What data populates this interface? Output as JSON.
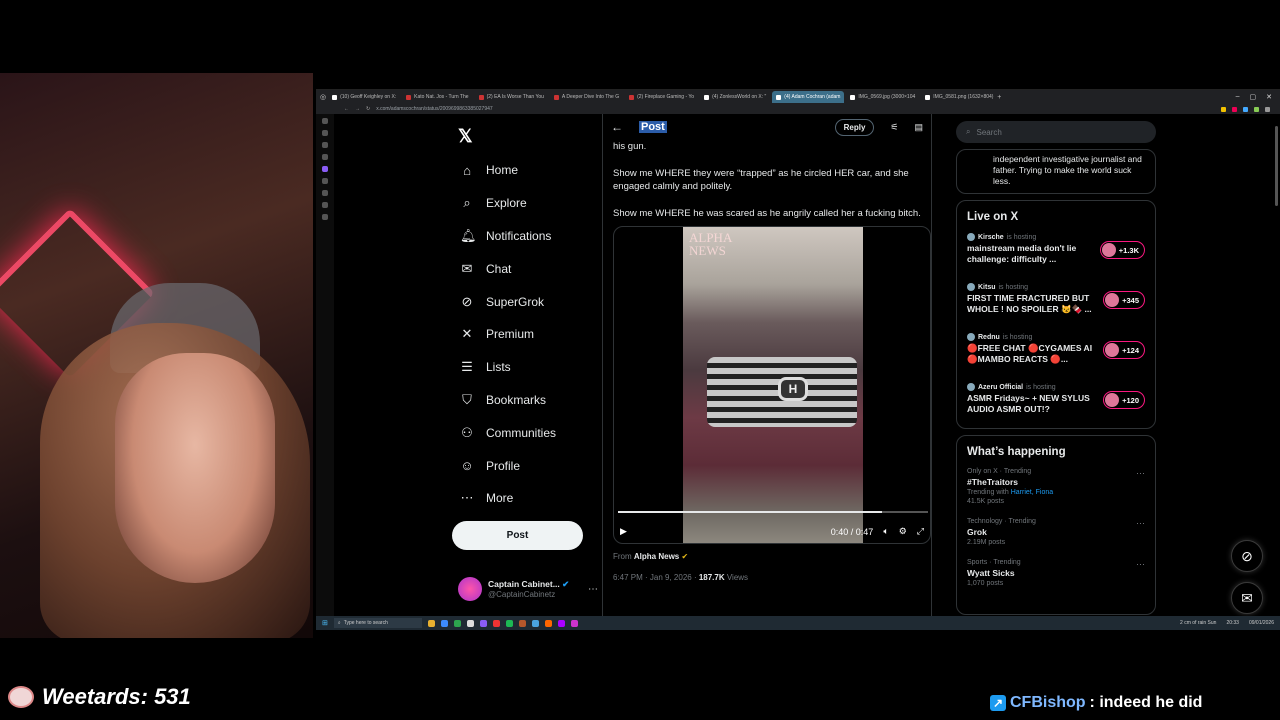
{
  "overlay": {
    "counter_text": "Weetards: 531",
    "chat_user": "CFBishop",
    "chat_message": ": indeed he did"
  },
  "browser": {
    "tabs": [
      {
        "label": "(10) Geoff Keighley on X:"
      },
      {
        "label": "Kato Nat. Jos - Turn The"
      },
      {
        "label": "(2) EA Is Worse Than You"
      },
      {
        "label": "A Deeper Dive Into The G"
      },
      {
        "label": "(2) Fireplace Gaming - Yo"
      },
      {
        "label": "(4) ZonlessWorld on X: \""
      },
      {
        "label": "(4) Adam Cochran (adam"
      },
      {
        "label": "IMG_0569.jpg (3000×104"
      },
      {
        "label": "IMG_0581.png (1632×804)"
      }
    ],
    "url": "x.com/adamscochran/status/2009699863385027947"
  },
  "nav": {
    "items": [
      {
        "label": "Home",
        "icon": "home-icon",
        "glyph": "⌂"
      },
      {
        "label": "Explore",
        "icon": "search-icon",
        "glyph": "⌕"
      },
      {
        "label": "Notifications",
        "icon": "bell-icon",
        "glyph": "♫"
      },
      {
        "label": "Chat",
        "icon": "mail-icon",
        "glyph": "✉"
      },
      {
        "label": "SuperGrok",
        "icon": "grok-icon",
        "glyph": "⊘"
      },
      {
        "label": "Premium",
        "icon": "x-logo-icon",
        "glyph": "✕"
      },
      {
        "label": "Lists",
        "icon": "list-icon",
        "glyph": "☰"
      },
      {
        "label": "Bookmarks",
        "icon": "bookmark-icon",
        "glyph": "⛉"
      },
      {
        "label": "Communities",
        "icon": "people-icon",
        "glyph": "⚇"
      },
      {
        "label": "Profile",
        "icon": "person-icon",
        "glyph": "☺"
      },
      {
        "label": "More",
        "icon": "more-circle-icon",
        "glyph": "⋯"
      }
    ],
    "post_button": "Post",
    "account": {
      "name": "Captain Cabinet...",
      "handle": "@CaptainCabinetz"
    }
  },
  "post": {
    "header_title": "Post",
    "reply_button": "Reply",
    "paragraphs": [
      "his gun.",
      "Show me WHERE they were “trapped” as he circled HER car, and she engaged calmly and politely.",
      "Show me WHERE he was scared as he angrily called her a fucking bitch."
    ],
    "video": {
      "watermark_line1": "ALPHA",
      "watermark_line2": "NEWS",
      "time": "0:40 / 0:47",
      "progress": 0.85
    },
    "from_label": "From ",
    "from_source": "Alpha News",
    "timestamp": "6:47 PM · Jan 9, 2026 · ",
    "views": "187.7K",
    "views_label": " Views"
  },
  "sidebar": {
    "search_placeholder": "Search",
    "bio": "independent investigative journalist and father. Trying to make the world suck less.",
    "live_title": "Live on X",
    "live": [
      {
        "host": "Kirsche",
        "status": "is hosting",
        "title": "mainstream media don't lie challenge: difficulty ...",
        "count": "+1.3K"
      },
      {
        "host": "Kitsu",
        "status": "is hosting",
        "title": "FIRST TIME FRACTURED BUT WHOLE ! NO SPOILER 😼🍫 ...",
        "count": "+345"
      },
      {
        "host": "Rednu",
        "status": "is hosting",
        "title": "🔴FREE CHAT 🔴CYGAMES AI 🔴MAMBO REACTS 🔴...",
        "count": "+124"
      },
      {
        "host": "Azeru Official",
        "status": "is hosting",
        "title": "ASMR Fridays~ + NEW SYLUS AUDIO ASMR OUT!?",
        "count": "+120"
      }
    ],
    "happening_title": "What’s happening",
    "trends": [
      {
        "context": "Only on X · Trending",
        "name": "#TheTraitors",
        "sub_prefix": "Trending with ",
        "sub_links": "Harriet, Fiona",
        "posts": "41.5K posts"
      },
      {
        "context": "Technology · Trending",
        "name": "Grok",
        "sub_prefix": "",
        "sub_links": "",
        "posts": "2.19M posts"
      },
      {
        "context": "Sports · Trending",
        "name": "Wyatt Sicks",
        "sub_prefix": "",
        "sub_links": "",
        "posts": "1,070 posts"
      }
    ]
  },
  "taskbar": {
    "search_placeholder": "Type here to search",
    "weather": "2 cm of rain Sun",
    "time": "20:33",
    "date": "09/01/2026"
  }
}
